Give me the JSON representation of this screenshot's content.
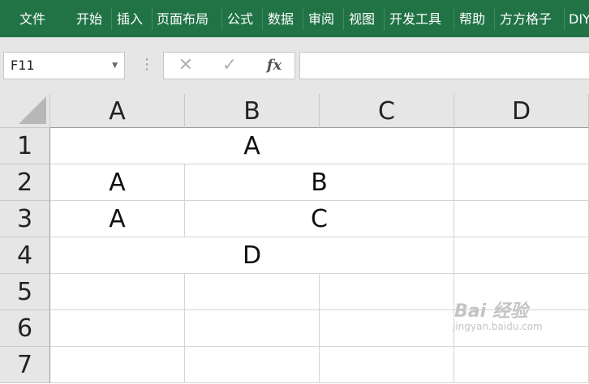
{
  "ribbon": {
    "tabs": [
      "文件",
      "开始",
      "插入",
      "页面布局",
      "公式",
      "数据",
      "审阅",
      "视图",
      "开发工具",
      "帮助",
      "方方格子",
      "DIY"
    ]
  },
  "formula_bar": {
    "name_box": "F11",
    "cancel_symbol": "✕",
    "enter_symbol": "✓",
    "fx_label": "fx",
    "formula_value": ""
  },
  "sheet": {
    "columns": [
      "A",
      "B",
      "C",
      "D"
    ],
    "rows": [
      "1",
      "2",
      "3",
      "4",
      "5",
      "6",
      "7"
    ],
    "cells": {
      "r1_merged_abc": "A",
      "r2_a": "A",
      "r2_merged_bc": "B",
      "r3_a": "A",
      "r3_merged_bc": "C",
      "r4_merged_abc": "D"
    }
  },
  "colors": {
    "ribbon_green": "#217346",
    "header_gray": "#e6e6e6",
    "gridline": "#d4d4d4"
  },
  "watermark": {
    "main": "Bai 经验",
    "sub": "jingyan.baidu.com"
  }
}
